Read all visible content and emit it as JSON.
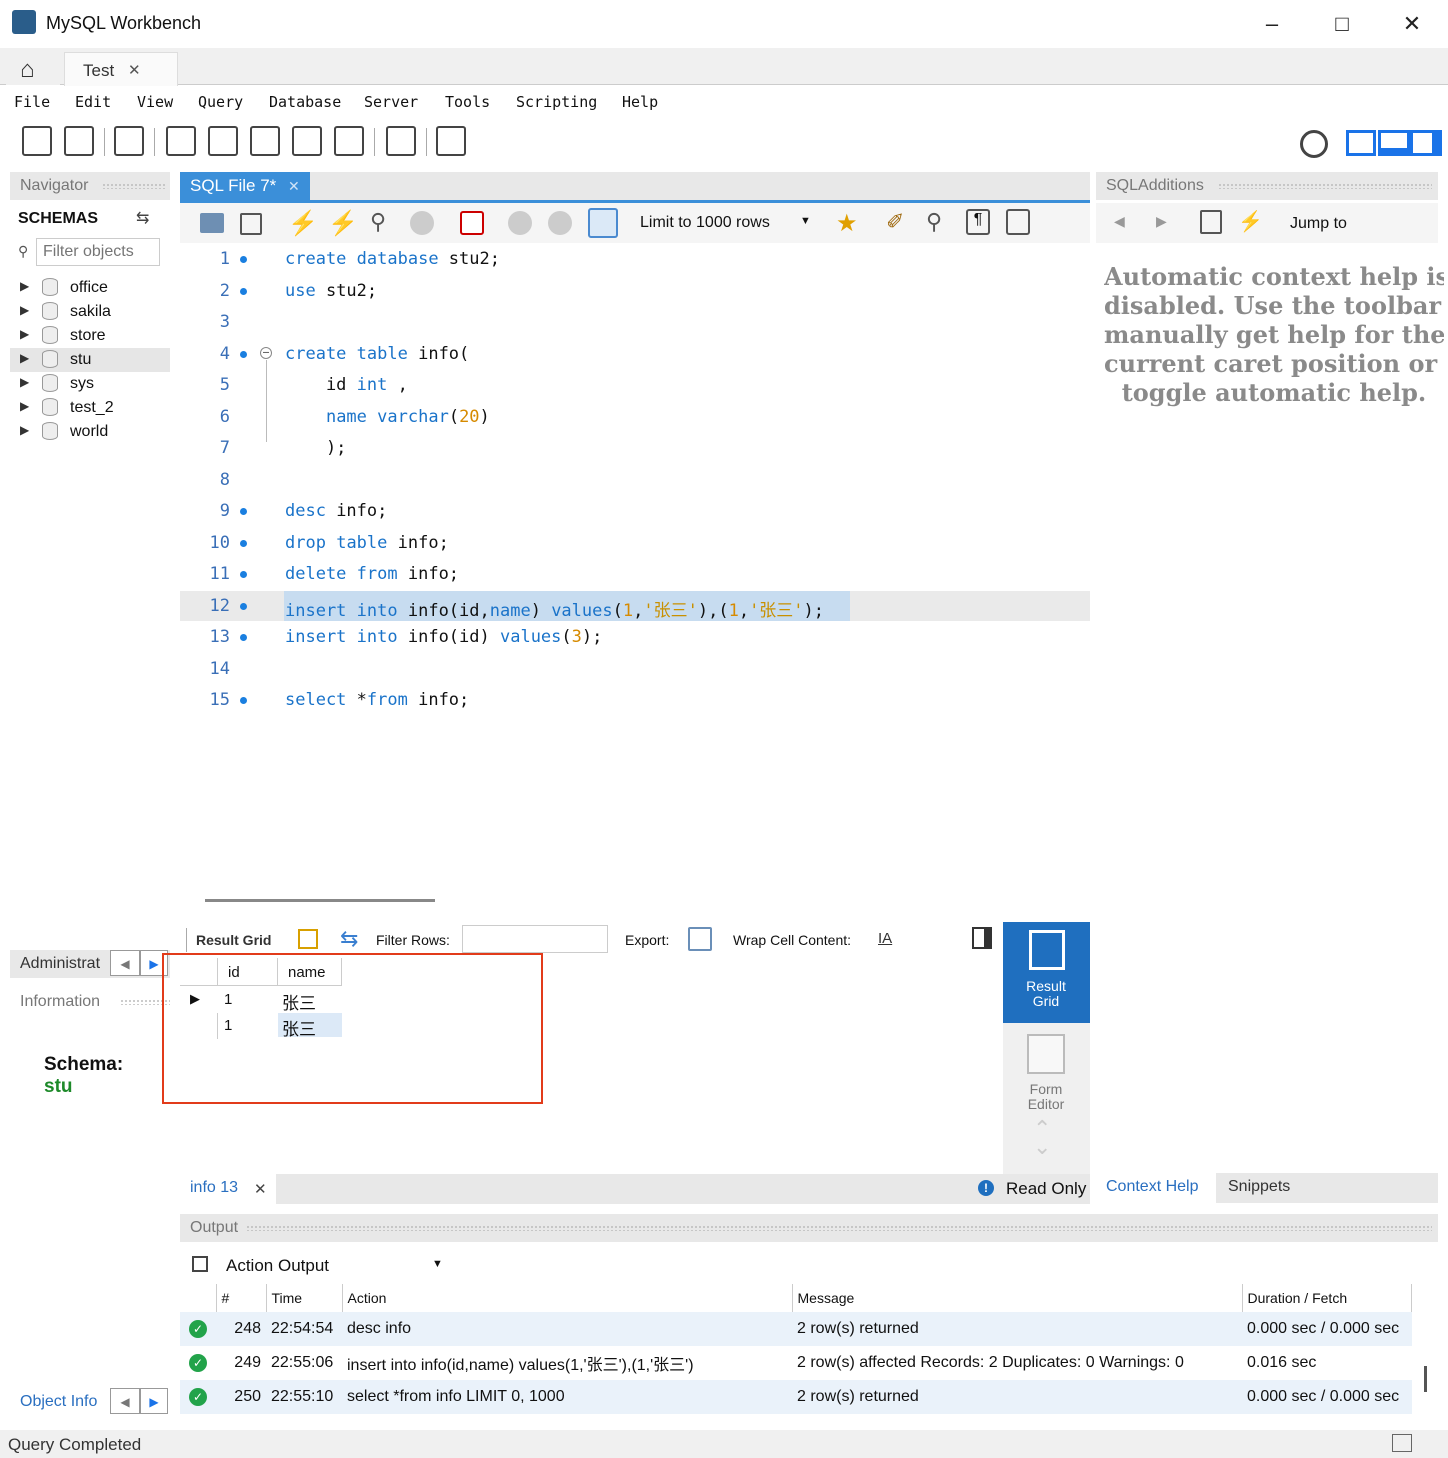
{
  "window": {
    "title": "MySQL Workbench",
    "tab": "Test"
  },
  "menu": [
    "File",
    "Edit",
    "View",
    "Query",
    "Database",
    "Server",
    "Tools",
    "Scripting",
    "Help"
  ],
  "navigator": {
    "header": "Navigator",
    "schemas_label": "SCHEMAS",
    "filter_placeholder": "Filter objects",
    "schemas": [
      "office",
      "sakila",
      "store",
      "stu",
      "sys",
      "test_2",
      "world"
    ],
    "selected": "stu",
    "admin_tab": "Administrat",
    "info_header": "Information",
    "schema_label": "Schema:",
    "schema_value": "stu",
    "object_info": "Object Info"
  },
  "editor": {
    "tab": "SQL File 7*",
    "limit": "Limit to 1000 rows",
    "lines": [
      {
        "n": "1",
        "code": "create database stu2;"
      },
      {
        "n": "2",
        "code": "use stu2;"
      },
      {
        "n": "3",
        "code": ""
      },
      {
        "n": "4",
        "code": "create table info("
      },
      {
        "n": "5",
        "code": "    id int ,"
      },
      {
        "n": "6",
        "code": "    name varchar(20)"
      },
      {
        "n": "7",
        "code": "    );"
      },
      {
        "n": "8",
        "code": ""
      },
      {
        "n": "9",
        "code": "desc info;"
      },
      {
        "n": "10",
        "code": "drop table info;"
      },
      {
        "n": "11",
        "code": "delete from info;"
      },
      {
        "n": "12",
        "code": "insert into info(id,name) values(1,'张三'),(1,'张三');"
      },
      {
        "n": "13",
        "code": "insert into info(id) values(3);"
      },
      {
        "n": "14",
        "code": ""
      },
      {
        "n": "15",
        "code": "select *from info;"
      }
    ]
  },
  "result": {
    "grid_label": "Result Grid",
    "filter_label": "Filter Rows:",
    "export_label": "Export:",
    "wrap_label": "Wrap Cell Content:",
    "columns": [
      "id",
      "name"
    ],
    "rows": [
      [
        "1",
        "张三"
      ],
      [
        "1",
        "张三"
      ]
    ],
    "side_result": "Result Grid",
    "side_form": "Form Editor",
    "result_tab": "info 13",
    "read_only": "Read Only"
  },
  "sqladditions": {
    "header": "SQLAdditions",
    "jump": "Jump to",
    "help_lines": [
      "Automatic context help is",
      "disabled. Use the toolbar t",
      "manually get help for the",
      "current caret position or to",
      "toggle automatic help."
    ],
    "tab_context": "Context Help",
    "tab_snippets": "Snippets"
  },
  "output": {
    "header": "Output",
    "selector": "Action Output",
    "columns": [
      "#",
      "Time",
      "Action",
      "Message",
      "Duration / Fetch"
    ],
    "rows": [
      {
        "num": "248",
        "time": "22:54:54",
        "action": "desc info",
        "message": "2 row(s) returned",
        "duration": "0.000 sec / 0.000 sec"
      },
      {
        "num": "249",
        "time": "22:55:06",
        "action": "insert into info(id,name) values(1,'张三'),(1,'张三')",
        "message": "2 row(s) affected Records: 2  Duplicates: 0  Warnings: 0",
        "duration": "0.016 sec"
      },
      {
        "num": "250",
        "time": "22:55:10",
        "action": "select *from info LIMIT 0, 1000",
        "message": "2 row(s) returned",
        "duration": "0.000 sec / 0.000 sec"
      }
    ]
  },
  "status": "Query Completed",
  "colors": {
    "accent": "#3b8fd9",
    "highlight": "#e23b1a",
    "ok": "#22a34a"
  }
}
